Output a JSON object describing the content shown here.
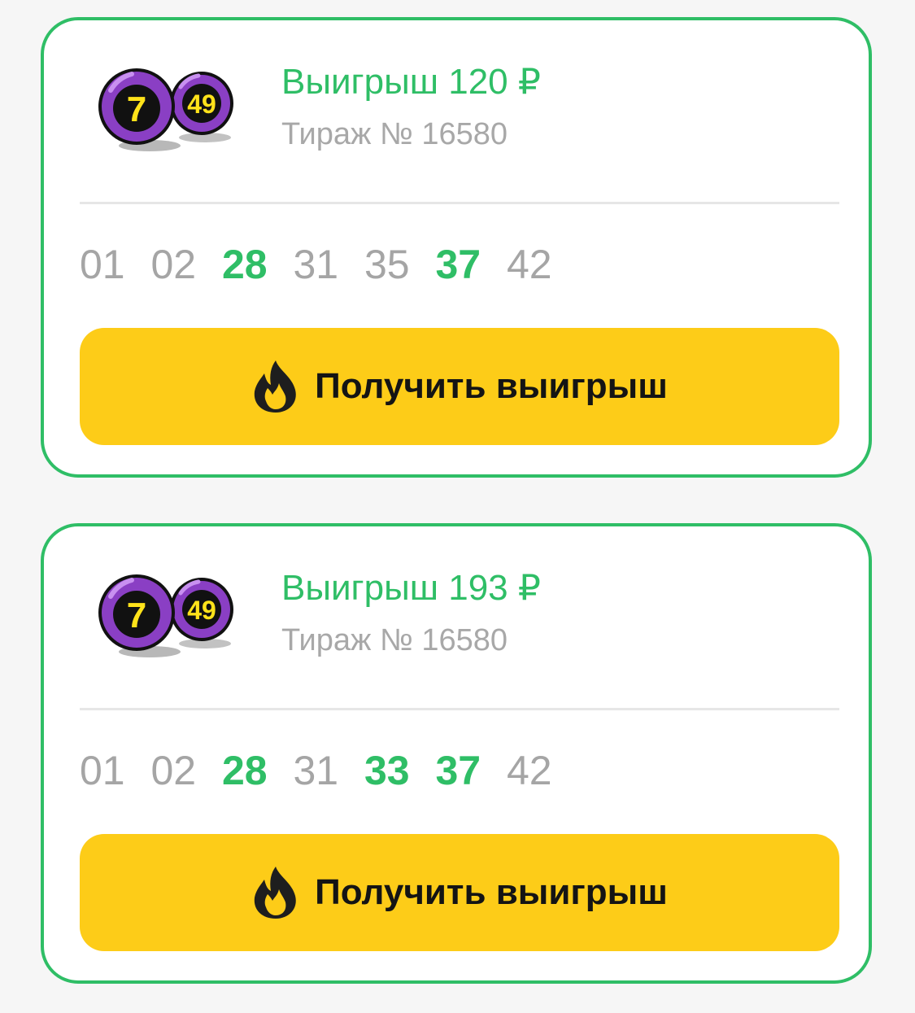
{
  "colors": {
    "accent_green": "#2fbe66",
    "button_yellow": "#fdcc18",
    "muted_gray": "#a5a5a5"
  },
  "tickets": [
    {
      "logo": {
        "icon": "lottery-7-49-balls-icon",
        "ball_1": "7",
        "ball_2": "49"
      },
      "title": "Выигрыш 120 ₽",
      "draw": "Тираж № 16580",
      "numbers": [
        {
          "value": "01",
          "matched": false
        },
        {
          "value": "02",
          "matched": false
        },
        {
          "value": "28",
          "matched": true
        },
        {
          "value": "31",
          "matched": false
        },
        {
          "value": "35",
          "matched": false
        },
        {
          "value": "37",
          "matched": true
        },
        {
          "value": "42",
          "matched": false
        }
      ],
      "button": {
        "icon": "flame-icon",
        "label": "Получить выигрыш"
      }
    },
    {
      "logo": {
        "icon": "lottery-7-49-balls-icon",
        "ball_1": "7",
        "ball_2": "49"
      },
      "title": "Выигрыш 193 ₽",
      "draw": "Тираж № 16580",
      "numbers": [
        {
          "value": "01",
          "matched": false
        },
        {
          "value": "02",
          "matched": false
        },
        {
          "value": "28",
          "matched": true
        },
        {
          "value": "31",
          "matched": false
        },
        {
          "value": "33",
          "matched": true
        },
        {
          "value": "37",
          "matched": true
        },
        {
          "value": "42",
          "matched": false
        }
      ],
      "button": {
        "icon": "flame-icon",
        "label": "Получить выигрыш"
      }
    }
  ]
}
